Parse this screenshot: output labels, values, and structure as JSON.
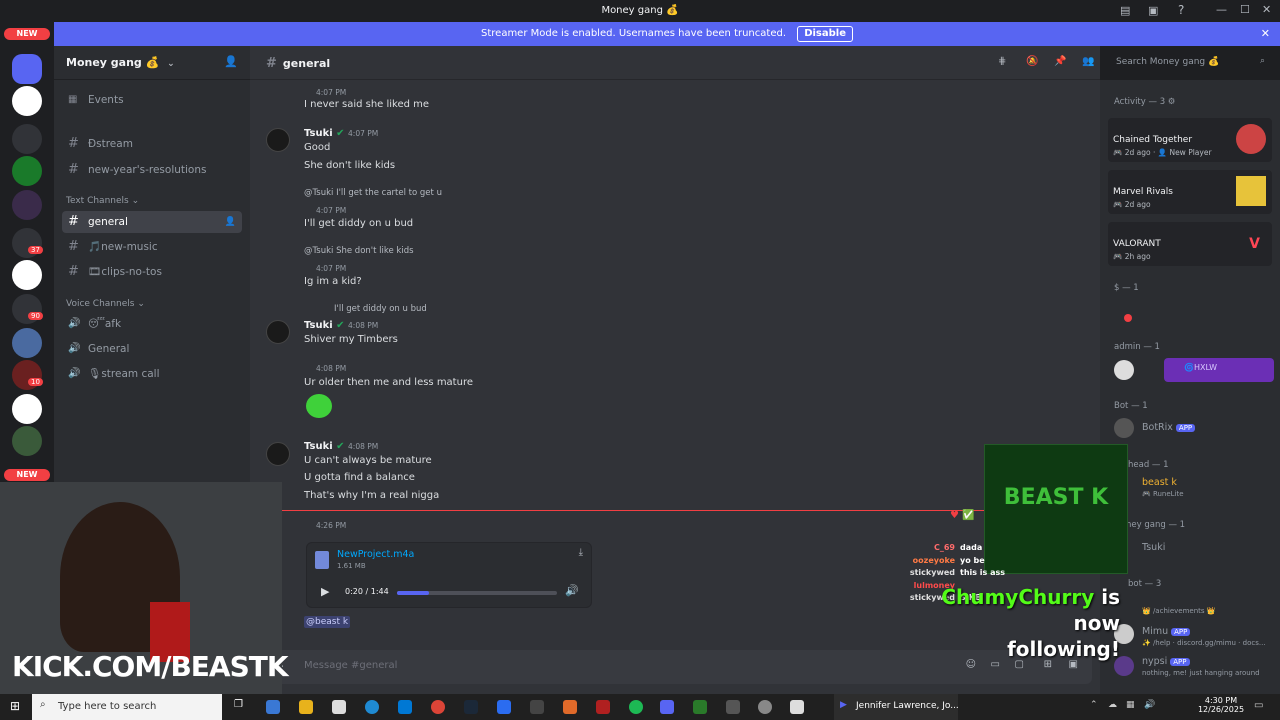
{
  "window": {
    "title": "Money gang 💰"
  },
  "banner": {
    "text": "Streamer Mode is enabled. Usernames have been truncated.",
    "button": "Disable"
  },
  "guild_badges": {
    "new_top": "NEW",
    "new_bottom": "NEW",
    "badge_37": "37",
    "badge_90": "90",
    "badge_10": "10"
  },
  "server": {
    "name": "Money gang 💰"
  },
  "channels": {
    "events": "Events",
    "dstream": "Ðstream",
    "resolutions": "new-year's-resolutions",
    "text_category": "Text Channels",
    "general": "general",
    "new_music": "🎵new-music",
    "clips": "🎞clips-no-tos",
    "voice_category": "Voice Channels",
    "afk": "😴afk",
    "general_voice": "General",
    "stream_call": "🎙stream call"
  },
  "header": {
    "channel": "general",
    "search_placeholder": "Search Money gang 💰"
  },
  "messages": {
    "m1_time": "4:07 PM",
    "m1_text": "I never said she liked me",
    "m2_author": "Tsuki",
    "m2_time": "4:07 PM",
    "m2_line1": "Good",
    "m2_line2": "She don't like kids",
    "m3_reply": "@Tsuki I'll get the cartel to get u",
    "m3_time": "4:07 PM",
    "m3_text": "I'll get diddy on u bud",
    "m4_reply": "@Tsuki She don't like kids",
    "m4_time": "4:07 PM",
    "m4_text": "Ig im a kid?",
    "m5_reply": "I'll get diddy on u bud",
    "m5_author": "Tsuki",
    "m5_time": "4:08 PM",
    "m5_text": "Shiver my Timbers",
    "m6_time": "4:08 PM",
    "m6_text": "Ur older then me and less mature",
    "m7_author": "Tsuki",
    "m7_time": "4:08 PM",
    "m7_line1": "U can't always be mature",
    "m7_line2": "U gotta find a balance",
    "m7_line3": "That's why I'm a real nigga",
    "m8_time": "4:26 PM",
    "attachment_name": "NewProject.m4a",
    "attachment_size": "1.61 MB",
    "audio_time": "0:20 / 1:44",
    "audio_progress": 0.2,
    "mention": "@beast k"
  },
  "input": {
    "placeholder": "Message #general"
  },
  "members": {
    "activity_header": "Activity — 3",
    "act1_name": "Chained Together",
    "act1_sub": "🎮 2d ago · 👤 New Player",
    "act2_name": "Marvel Rivals",
    "act2_sub": "🎮 2d ago",
    "act3_name": "VALORANT",
    "act3_sub": "🎮 2h ago",
    "g_dollar": "$ — 1",
    "g_admin": "admin — 1",
    "admin_tag": "🌀HXLW",
    "g_bot": "Bot — 1",
    "botrix": "BotRix",
    "app": "APP",
    "g_head": "head — 1",
    "beastk": "beast k",
    "beastk_sub": "🎮 RuneLite",
    "g_moneygang": "ney gang — 1",
    "tsuki": "Tsuki",
    "g_bot3": "bot — 3",
    "achievements": "👑 /achievements 👑",
    "mimu": "Mimu",
    "mimu_sub": "✨ /help · discord.gg/mimu · docs...",
    "nypsi": "nypsi",
    "nypsi_sub": "nothing, me! just hanging around"
  },
  "overlay": {
    "kick": "KICK.COM/BEASTK",
    "beastk_logo": "BEAST K",
    "follower": "ChumyChurry",
    "follow_text1": "is now",
    "follow_text2": "following!",
    "chat": [
      {
        "user": "C_69",
        "text": "dada",
        "color": "#ff6b6b"
      },
      {
        "user": "oozeyoke",
        "text": "yo be",
        "color": "#ff7a45"
      },
      {
        "user": "stickywed",
        "text": "this is ass",
        "color": "#e0e0e0"
      },
      {
        "user": "lulmoney",
        "text": "",
        "color": "#ff4b4b"
      },
      {
        "user": "stickywed",
        "text": "SIKE",
        "color": "#e0e0e0"
      }
    ]
  },
  "taskbar": {
    "search": "Type here to search",
    "app_label": "Jennifer Lawrence, Jo...",
    "time": "4:30 PM",
    "date": "12/26/2025"
  },
  "colors": {
    "accent": "#5865f2",
    "kick_green": "#53fc18",
    "online": "#23a55a"
  }
}
